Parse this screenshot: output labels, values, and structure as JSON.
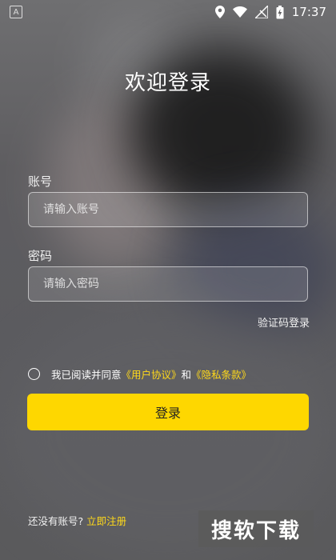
{
  "status_bar": {
    "notification_badge": "A",
    "time": "17:37"
  },
  "page": {
    "title": "欢迎登录"
  },
  "account": {
    "label": "账号",
    "placeholder": "请输入账号",
    "value": ""
  },
  "password": {
    "label": "密码",
    "placeholder": "请输入密码",
    "value": ""
  },
  "code_login_link": "验证码登录",
  "agreement": {
    "prefix": "我已阅读并同意",
    "user_agreement": "《用户协议》",
    "conjunction": "和",
    "privacy_policy": "《隐私条款》",
    "checked": false
  },
  "login_button": "登录",
  "register": {
    "prompt": "还没有账号?",
    "link": "立即注册"
  },
  "watermark": "搜软下载",
  "colors": {
    "accent": "#fed700",
    "link": "#ffd91a"
  }
}
